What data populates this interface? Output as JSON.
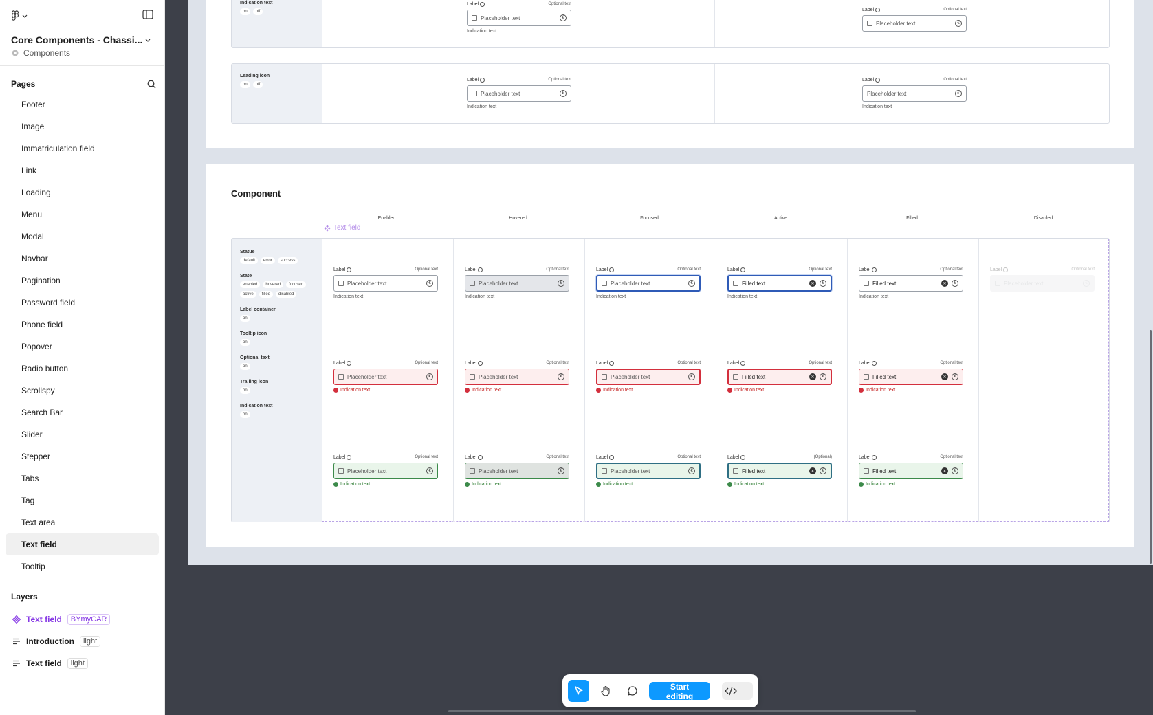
{
  "file": {
    "title": "Core Components - Chassi...",
    "subtitle": "Components"
  },
  "pages": {
    "title": "Pages",
    "items": [
      "Footer",
      "Image",
      "Immatriculation field",
      "Link",
      "Loading",
      "Menu",
      "Modal",
      "Navbar",
      "Pagination",
      "Password field",
      "Phone field",
      "Popover",
      "Radio button",
      "Scrollspy",
      "Search Bar",
      "Slider",
      "Stepper",
      "Tabs",
      "Tag",
      "Text area",
      "Text field",
      "Tooltip"
    ],
    "selected": "Text field"
  },
  "layers": {
    "title": "Layers",
    "items": [
      {
        "name": "Text field",
        "tag": "BYmyCAR"
      },
      {
        "name": "Introduction",
        "tag": "light"
      },
      {
        "name": "Text field",
        "tag": "light"
      }
    ]
  },
  "top_rows": [
    {
      "title": "Indication text",
      "chips": [
        "on",
        "off"
      ]
    },
    {
      "title": "Leading icon",
      "chips": [
        "on",
        "off"
      ]
    }
  ],
  "field_text": {
    "label": "Label",
    "optional": "Optional text",
    "optional_paren": "(Optional)",
    "placeholder": "Placeholder text",
    "filled": "Filled text",
    "indication": "Indication text"
  },
  "component": {
    "title": "Component",
    "frame_name": "Text field",
    "columns": [
      "Enabled",
      "Hovered",
      "Focused",
      "Active",
      "Filled",
      "Disabled"
    ],
    "props": [
      {
        "title": "Statue",
        "chips": [
          "default",
          "error",
          "success"
        ]
      },
      {
        "title": "State",
        "chips": [
          "enabled",
          "hovered",
          "focused",
          "active",
          "filled",
          "disabled"
        ]
      },
      {
        "title": "Label container",
        "chips": [
          "on"
        ]
      },
      {
        "title": "Tooltip icon",
        "chips": [
          "on"
        ]
      },
      {
        "title": "Optional text",
        "chips": [
          "on"
        ]
      },
      {
        "title": "Trailing icon",
        "chips": [
          "on"
        ]
      },
      {
        "title": "Indication text",
        "chips": [
          "on"
        ]
      }
    ]
  },
  "toolbar": {
    "start_editing": "Start editing"
  },
  "colors": {
    "accent": "#0d99ff",
    "error": "#d32f3d",
    "success": "#3c8a4a",
    "focus": "#2f5bb7",
    "component_purple": "#8638e5"
  }
}
